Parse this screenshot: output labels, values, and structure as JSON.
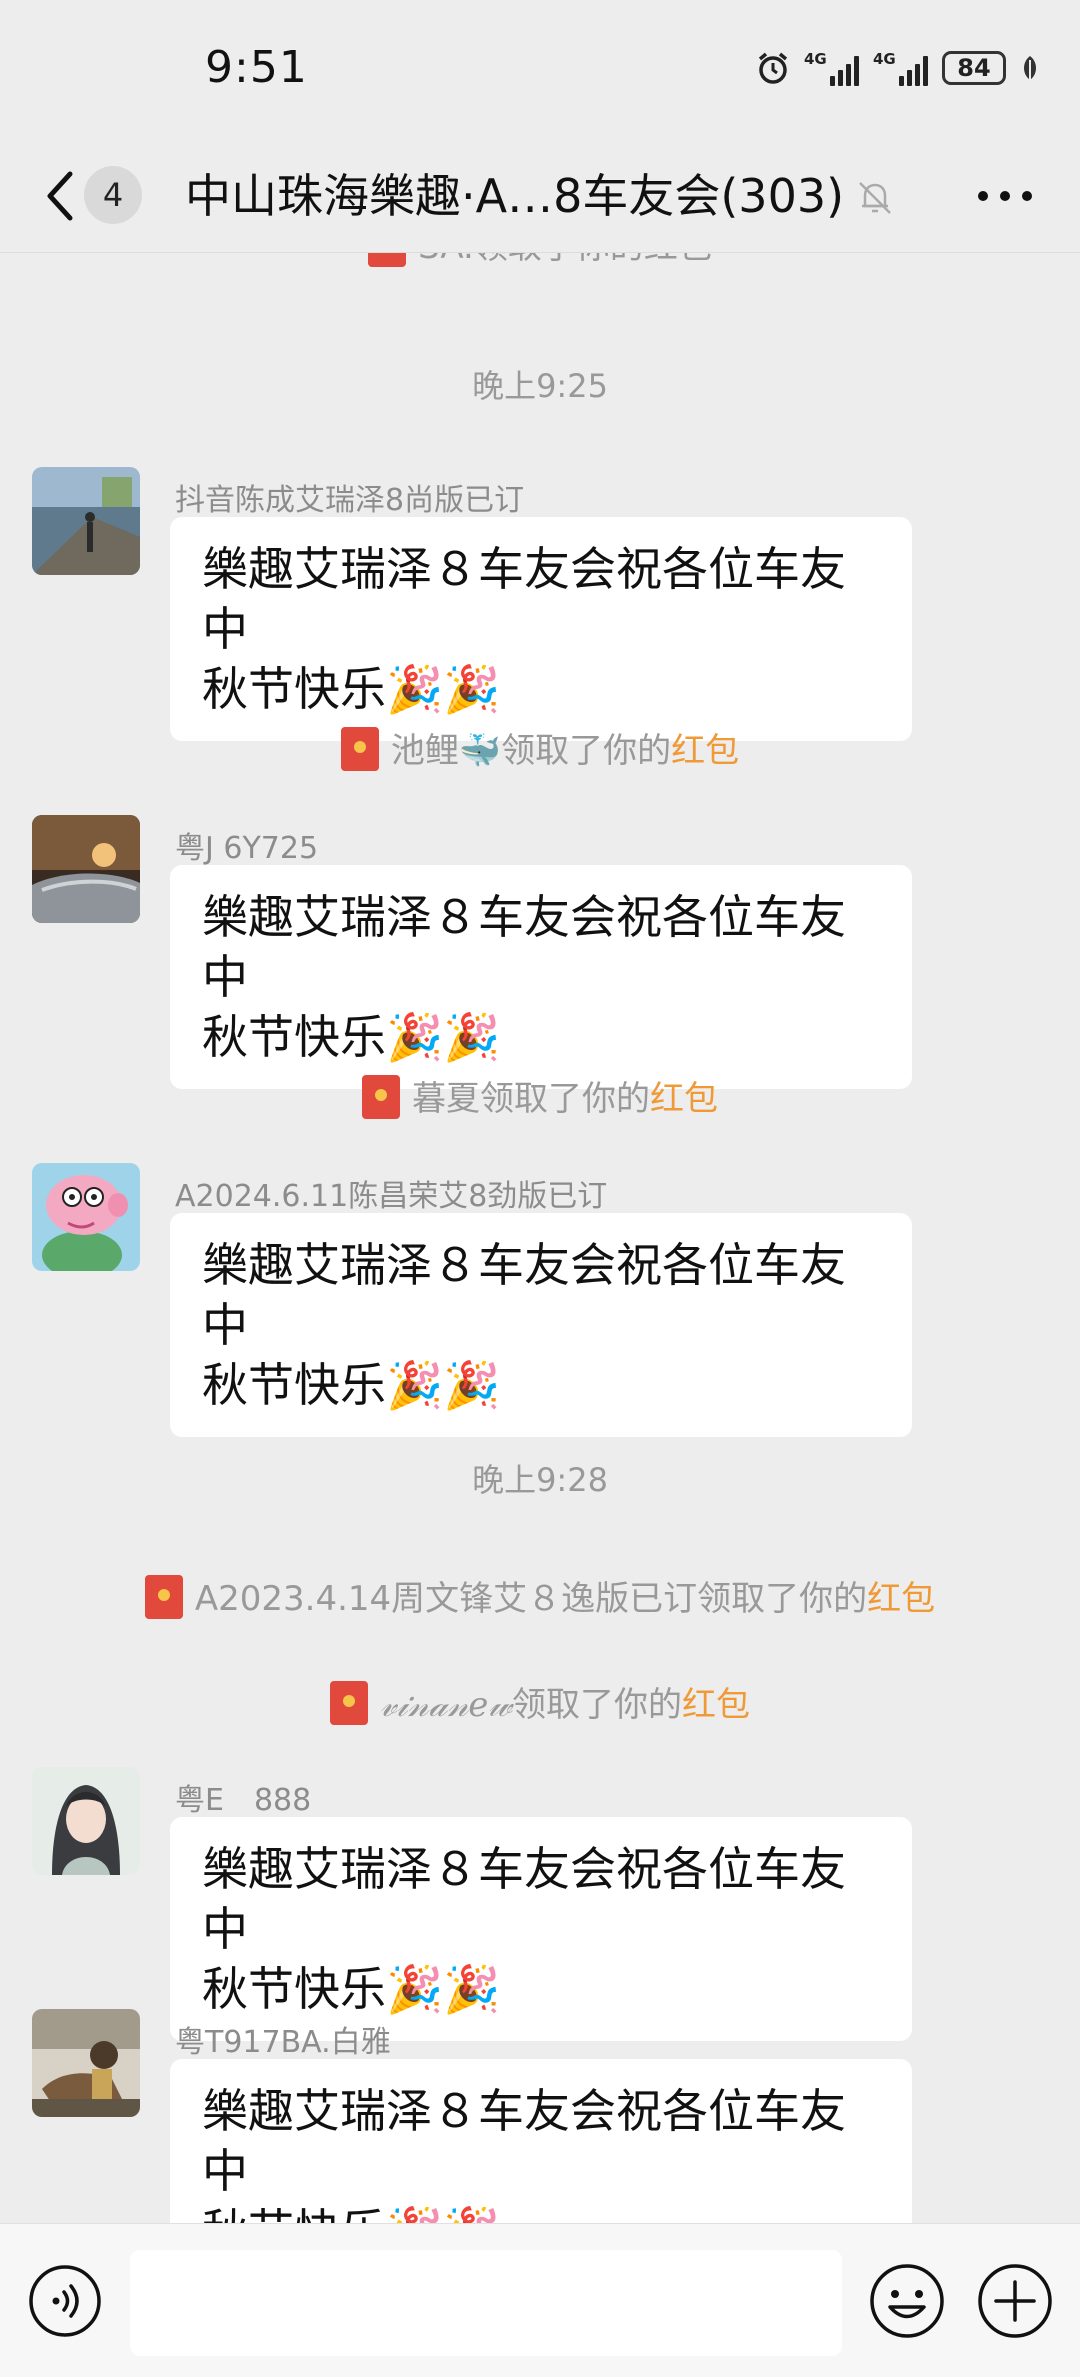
{
  "status": {
    "time": "9:51",
    "network1": "4G",
    "network2": "4G",
    "battery": "84"
  },
  "header": {
    "unread_count": "4",
    "title": "中山珠海樂趣·A…8车友会(303)"
  },
  "chat": {
    "top_partial": "SA.领取了你的红包",
    "timestamp1": "晚上9:25",
    "timestamp2": "晚上9:28",
    "messages": [
      {
        "sender": "抖音陈成艾瑞泽8尚版已订",
        "line1": "樂趣艾瑞泽８车友会祝各位车友中",
        "line2": "秋节快乐🎉🎉"
      },
      {
        "sender": "粤J 6Y725",
        "line1": "樂趣艾瑞泽８车友会祝各位车友中",
        "line2": "秋节快乐🎉🎉"
      },
      {
        "sender": "A2024.6.11陈昌荣艾8劲版已订",
        "line1": "樂趣艾瑞泽８车友会祝各位车友中",
        "line2": "秋节快乐🎉🎉"
      },
      {
        "sender": "粤E　888",
        "line1": "樂趣艾瑞泽８车友会祝各位车友中",
        "line2": "秋节快乐🎉🎉"
      },
      {
        "sender": "粤T917BA.白雅",
        "line1": "樂趣艾瑞泽８车友会祝各位车友中",
        "line2": "秋节快乐🎉🎉"
      }
    ],
    "system": [
      {
        "name": "池鲤🐳",
        "text": "领取了你的",
        "link": "红包"
      },
      {
        "name": "暮夏",
        "text": "领取了你的",
        "link": "红包"
      },
      {
        "name": "A2023.4.14周文锋艾８逸版已订",
        "text": "领取了你的",
        "link": "红包"
      },
      {
        "name": "𝓋𝒾𝓃𝒶𝓃𝑒𝓌",
        "text": "领取了你的",
        "link": "红包"
      }
    ]
  },
  "colors": {
    "background": "#ededed",
    "bubble": "#ffffff",
    "link": "#f09a37",
    "envelope": "#e0493b"
  },
  "icons": [
    "back-arrow-icon",
    "alarm-icon",
    "signal-icon",
    "battery-icon",
    "leaf-icon",
    "mute-bell-icon",
    "more-icon",
    "voice-icon",
    "emoji-icon",
    "plus-icon",
    "red-envelope-icon"
  ]
}
